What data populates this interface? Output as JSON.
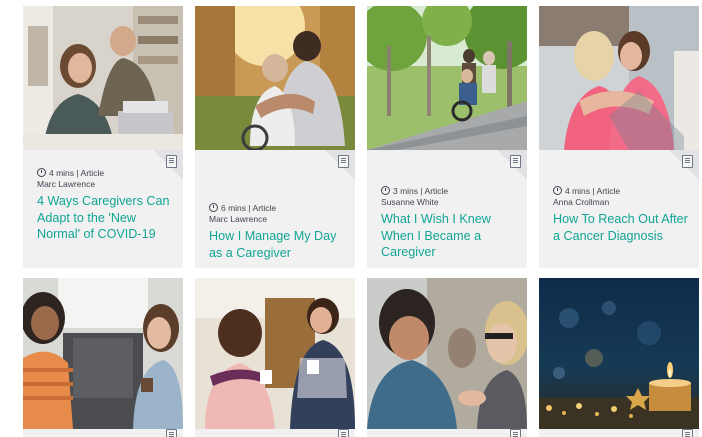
{
  "cards": [
    {
      "meta_time": "4 mins",
      "meta_sep": "|",
      "meta_type": "Article",
      "author": "Marc Lawrence",
      "title": "4 Ways Caregivers Can Adapt to the 'New Normal' of COVID-19",
      "image": "woman-and-man-at-laptop",
      "icon": "article-icon"
    },
    {
      "meta_time": "6 mins",
      "meta_sep": "|",
      "meta_type": "Article",
      "author": "Marc Lawrence",
      "title": "How I Manage My Day as a Caregiver",
      "image": "caregiver-hugging-person-in-wheelchair",
      "icon": "article-icon"
    },
    {
      "meta_time": "3 mins",
      "meta_sep": "|",
      "meta_type": "Article",
      "author": "Susanne White",
      "title": "What I Wish I Knew When I Became a Caregiver",
      "image": "people-walking-with-wheelchair-in-park",
      "icon": "article-icon"
    },
    {
      "meta_time": "4 mins",
      "meta_sep": "|",
      "meta_type": "Article",
      "author": "Anna Crollman",
      "title": "How To Reach Out After a Cancer Diagnosis",
      "image": "two-women-hugging",
      "icon": "article-icon"
    },
    {
      "image": "two-women-in-car",
      "icon": "article-icon"
    },
    {
      "image": "two-women-with-coffee",
      "icon": "article-icon"
    },
    {
      "image": "couple-embracing",
      "icon": "article-icon"
    },
    {
      "image": "candle-with-bokeh-lights",
      "icon": "article-icon"
    }
  ],
  "colors": {
    "title": "#11a594",
    "card_bg": "#f1f1f2",
    "meta_text": "#3f4650"
  }
}
